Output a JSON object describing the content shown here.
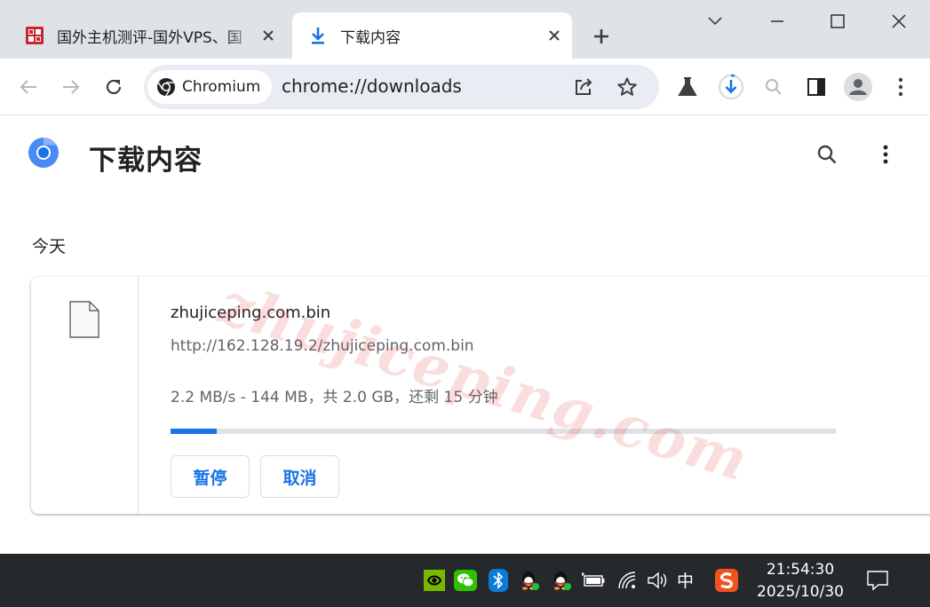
{
  "browser": {
    "tabs": [
      {
        "title": "国外主机测评-国外VPS、国",
        "favicon": "zhujiceping-seal-icon",
        "active": false
      },
      {
        "title": "下载内容",
        "favicon": "download-icon",
        "active": true
      }
    ],
    "omnibox": {
      "chip_label": "Chromium",
      "url": "chrome://downloads"
    }
  },
  "page": {
    "title": "下载内容",
    "date_heading": "今天",
    "download": {
      "file_name": "zhujiceping.com.bin",
      "url": "http://162.128.19.2/zhujiceping.com.bin",
      "status": "2.2 MB/s - 144 MB，共 2.0 GB，还剩 15 分钟",
      "progress_fraction": 0.07,
      "pause_label": "暂停",
      "cancel_label": "取消"
    },
    "watermark": "zhujiceping.com"
  },
  "taskbar": {
    "ime": "中",
    "time": "21:54:30",
    "date": "2025/10/30"
  },
  "colors": {
    "accent": "#1a73e8",
    "tabstrip": "#dfe3e8",
    "taskbar": "#26292c"
  }
}
